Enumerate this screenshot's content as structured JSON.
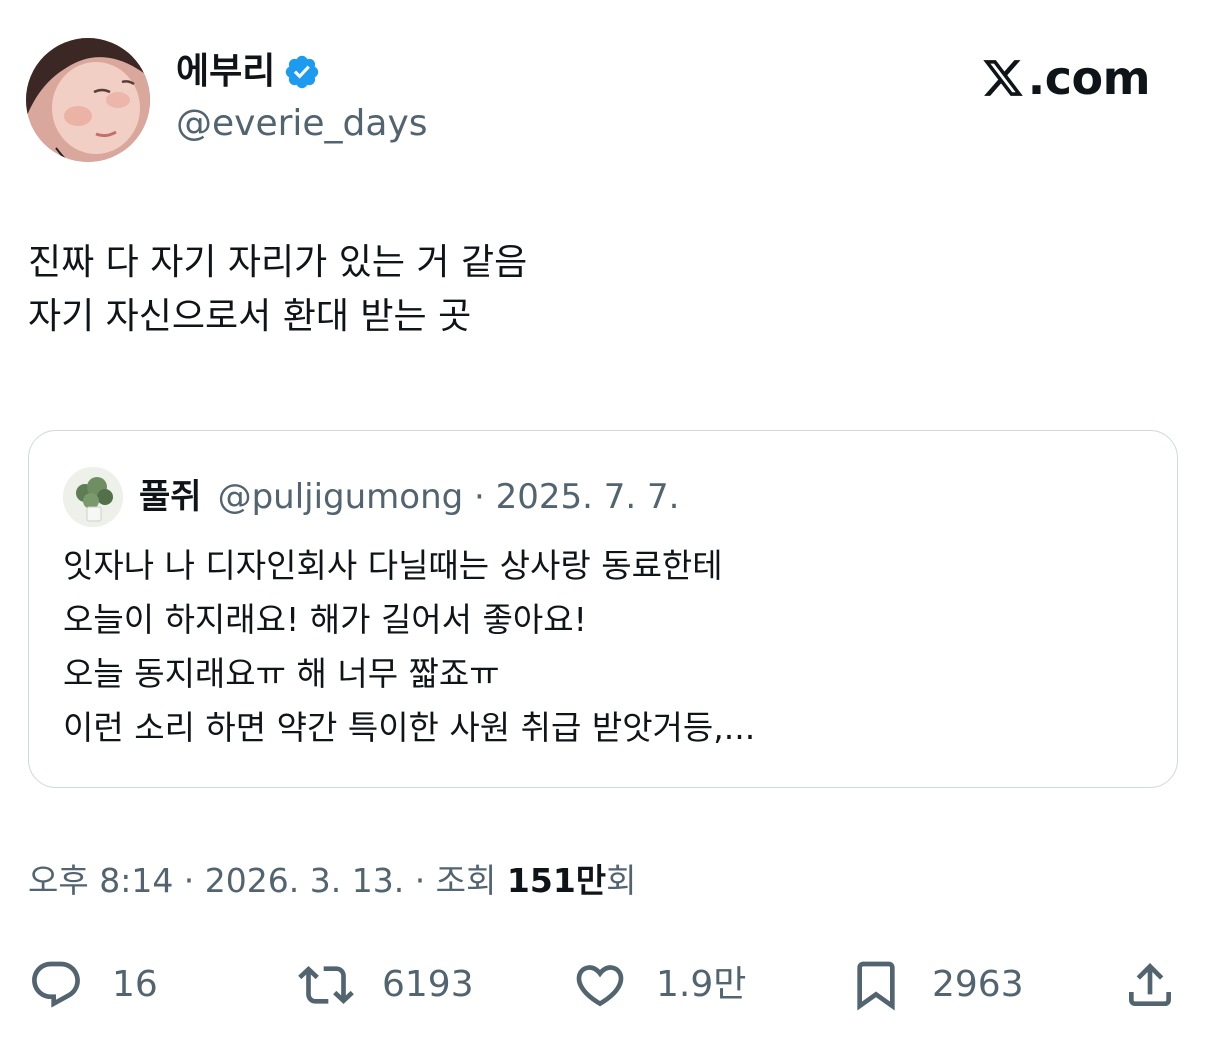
{
  "author": {
    "display_name": "에부리",
    "handle": "@everie_days",
    "verified": true,
    "avatar_icon": "profile-photo"
  },
  "brand": {
    "label": ".com",
    "icon": "x-logo-icon"
  },
  "tweet": {
    "lines": [
      "진짜 다 자기 자리가 있는 거 같음",
      "자기 자신으로서 환대 받는 곳"
    ]
  },
  "quote": {
    "display_name": "풀쥐",
    "handle_date": "@puljigumong · 2025. 7. 7.",
    "lines": [
      "잇자나 나 디자인회사 다닐때는 상사랑 동료한테",
      "오늘이 하지래요! 해가 길어서 좋아요!",
      "오늘 동지래요ㅠ 해 너무 짧죠ㅠ",
      "이런 소리 하면 약간 특이한 사원 취급 받앗거등,..."
    ]
  },
  "meta": {
    "time_date": "오후 8:14 · 2026. 3. 13. · 조회 ",
    "views_count": "151만",
    "views_suffix": "회"
  },
  "actions": {
    "replies": "16",
    "retweets": "6193",
    "likes": "1.9만",
    "bookmarks": "2963"
  },
  "colors": {
    "text": "#0f1419",
    "secondary": "#536471",
    "verified": "#1d9bf0",
    "border": "#cfd9de"
  }
}
